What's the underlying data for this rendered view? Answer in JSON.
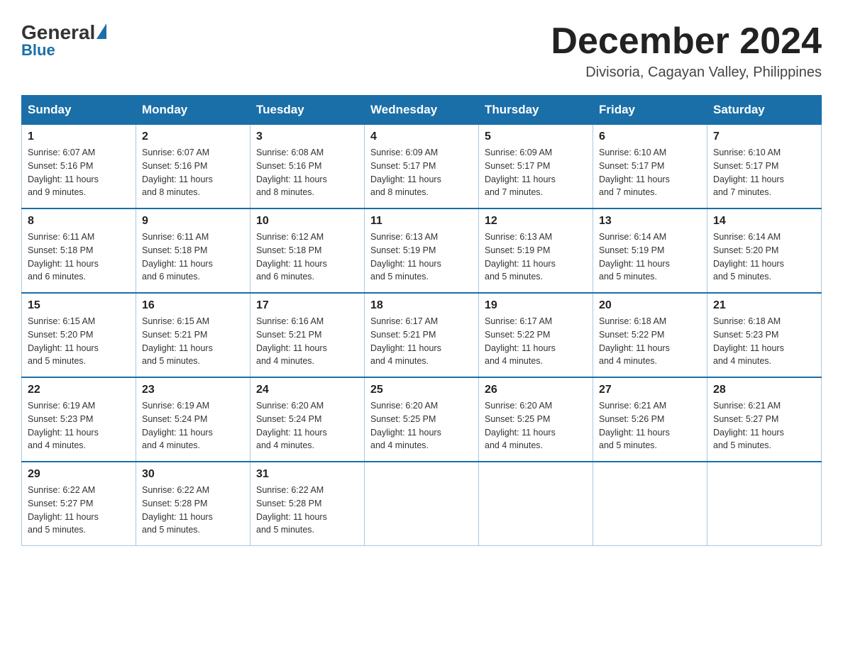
{
  "header": {
    "logo": {
      "general": "General",
      "blue": "Blue"
    },
    "title": "December 2024",
    "subtitle": "Divisoria, Cagayan Valley, Philippines"
  },
  "days_of_week": [
    "Sunday",
    "Monday",
    "Tuesday",
    "Wednesday",
    "Thursday",
    "Friday",
    "Saturday"
  ],
  "weeks": [
    [
      {
        "day": "1",
        "sunrise": "6:07 AM",
        "sunset": "5:16 PM",
        "daylight": "11 hours and 9 minutes."
      },
      {
        "day": "2",
        "sunrise": "6:07 AM",
        "sunset": "5:16 PM",
        "daylight": "11 hours and 8 minutes."
      },
      {
        "day": "3",
        "sunrise": "6:08 AM",
        "sunset": "5:16 PM",
        "daylight": "11 hours and 8 minutes."
      },
      {
        "day": "4",
        "sunrise": "6:09 AM",
        "sunset": "5:17 PM",
        "daylight": "11 hours and 8 minutes."
      },
      {
        "day": "5",
        "sunrise": "6:09 AM",
        "sunset": "5:17 PM",
        "daylight": "11 hours and 7 minutes."
      },
      {
        "day": "6",
        "sunrise": "6:10 AM",
        "sunset": "5:17 PM",
        "daylight": "11 hours and 7 minutes."
      },
      {
        "day": "7",
        "sunrise": "6:10 AM",
        "sunset": "5:17 PM",
        "daylight": "11 hours and 7 minutes."
      }
    ],
    [
      {
        "day": "8",
        "sunrise": "6:11 AM",
        "sunset": "5:18 PM",
        "daylight": "11 hours and 6 minutes."
      },
      {
        "day": "9",
        "sunrise": "6:11 AM",
        "sunset": "5:18 PM",
        "daylight": "11 hours and 6 minutes."
      },
      {
        "day": "10",
        "sunrise": "6:12 AM",
        "sunset": "5:18 PM",
        "daylight": "11 hours and 6 minutes."
      },
      {
        "day": "11",
        "sunrise": "6:13 AM",
        "sunset": "5:19 PM",
        "daylight": "11 hours and 5 minutes."
      },
      {
        "day": "12",
        "sunrise": "6:13 AM",
        "sunset": "5:19 PM",
        "daylight": "11 hours and 5 minutes."
      },
      {
        "day": "13",
        "sunrise": "6:14 AM",
        "sunset": "5:19 PM",
        "daylight": "11 hours and 5 minutes."
      },
      {
        "day": "14",
        "sunrise": "6:14 AM",
        "sunset": "5:20 PM",
        "daylight": "11 hours and 5 minutes."
      }
    ],
    [
      {
        "day": "15",
        "sunrise": "6:15 AM",
        "sunset": "5:20 PM",
        "daylight": "11 hours and 5 minutes."
      },
      {
        "day": "16",
        "sunrise": "6:15 AM",
        "sunset": "5:21 PM",
        "daylight": "11 hours and 5 minutes."
      },
      {
        "day": "17",
        "sunrise": "6:16 AM",
        "sunset": "5:21 PM",
        "daylight": "11 hours and 4 minutes."
      },
      {
        "day": "18",
        "sunrise": "6:17 AM",
        "sunset": "5:21 PM",
        "daylight": "11 hours and 4 minutes."
      },
      {
        "day": "19",
        "sunrise": "6:17 AM",
        "sunset": "5:22 PM",
        "daylight": "11 hours and 4 minutes."
      },
      {
        "day": "20",
        "sunrise": "6:18 AM",
        "sunset": "5:22 PM",
        "daylight": "11 hours and 4 minutes."
      },
      {
        "day": "21",
        "sunrise": "6:18 AM",
        "sunset": "5:23 PM",
        "daylight": "11 hours and 4 minutes."
      }
    ],
    [
      {
        "day": "22",
        "sunrise": "6:19 AM",
        "sunset": "5:23 PM",
        "daylight": "11 hours and 4 minutes."
      },
      {
        "day": "23",
        "sunrise": "6:19 AM",
        "sunset": "5:24 PM",
        "daylight": "11 hours and 4 minutes."
      },
      {
        "day": "24",
        "sunrise": "6:20 AM",
        "sunset": "5:24 PM",
        "daylight": "11 hours and 4 minutes."
      },
      {
        "day": "25",
        "sunrise": "6:20 AM",
        "sunset": "5:25 PM",
        "daylight": "11 hours and 4 minutes."
      },
      {
        "day": "26",
        "sunrise": "6:20 AM",
        "sunset": "5:25 PM",
        "daylight": "11 hours and 4 minutes."
      },
      {
        "day": "27",
        "sunrise": "6:21 AM",
        "sunset": "5:26 PM",
        "daylight": "11 hours and 5 minutes."
      },
      {
        "day": "28",
        "sunrise": "6:21 AM",
        "sunset": "5:27 PM",
        "daylight": "11 hours and 5 minutes."
      }
    ],
    [
      {
        "day": "29",
        "sunrise": "6:22 AM",
        "sunset": "5:27 PM",
        "daylight": "11 hours and 5 minutes."
      },
      {
        "day": "30",
        "sunrise": "6:22 AM",
        "sunset": "5:28 PM",
        "daylight": "11 hours and 5 minutes."
      },
      {
        "day": "31",
        "sunrise": "6:22 AM",
        "sunset": "5:28 PM",
        "daylight": "11 hours and 5 minutes."
      },
      null,
      null,
      null,
      null
    ]
  ],
  "labels": {
    "sunrise": "Sunrise:",
    "sunset": "Sunset:",
    "daylight": "Daylight:"
  }
}
